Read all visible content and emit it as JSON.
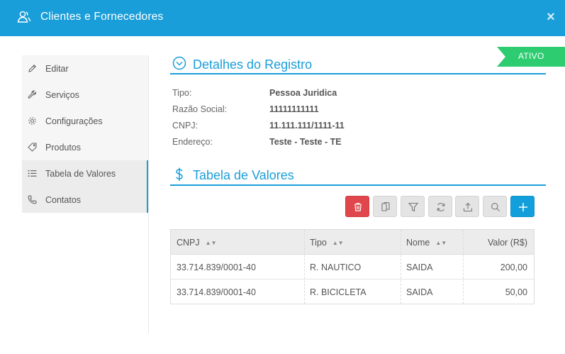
{
  "header": {
    "title": "Clientes e Fornecedores",
    "close_label": "×",
    "color": "#1a9ed9"
  },
  "sidebar": {
    "items": [
      {
        "label": "Editar",
        "icon": "pencil-icon"
      },
      {
        "label": "Serviços",
        "icon": "wrench-icon"
      },
      {
        "label": "Configurações",
        "icon": "gear-icon"
      },
      {
        "label": "Produtos",
        "icon": "tag-icon"
      },
      {
        "label": "Tabela de Valores",
        "icon": "list-icon",
        "active": true
      },
      {
        "label": "Contatos",
        "icon": "phone-icon",
        "active": true
      }
    ]
  },
  "status_badge": {
    "label": "ATIVO",
    "color": "#2ecc71"
  },
  "details": {
    "title": "Detalhes do Registro",
    "fields": [
      {
        "label": "Tipo:",
        "value": "Pessoa Juridica"
      },
      {
        "label": "Razão Social:",
        "value": "11111111111"
      },
      {
        "label": "CNPJ:",
        "value": "11.111.111/1111-11"
      },
      {
        "label": "Endereço:",
        "value": "Teste - Teste - TE"
      }
    ]
  },
  "values_section": {
    "title": "Tabela de Valores",
    "toolbar": [
      {
        "icon": "trash-icon",
        "color": "#e0474c"
      },
      {
        "icon": "copy-icon"
      },
      {
        "icon": "filter-icon"
      },
      {
        "icon": "refresh-icon"
      },
      {
        "icon": "upload-icon"
      },
      {
        "icon": "search-icon"
      },
      {
        "icon": "plus-icon",
        "color": "#129fdb"
      }
    ],
    "columns": [
      "CNPJ",
      "Tipo",
      "Nome",
      "Valor (R$)"
    ],
    "rows": [
      [
        "33.714.839/0001-40",
        "R. NAUTICO",
        "SAIDA",
        "200,00"
      ],
      [
        "33.714.839/0001-40",
        "R. BICICLETA",
        "SAIDA",
        "50,00"
      ]
    ]
  }
}
